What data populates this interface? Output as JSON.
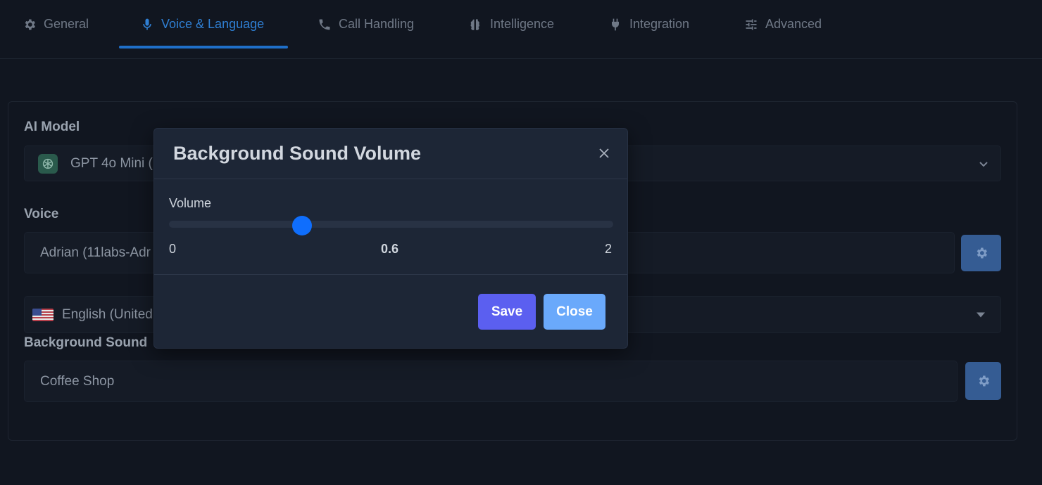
{
  "tabs": [
    {
      "label": "General",
      "icon": "gear-icon"
    },
    {
      "label": "Voice & Language",
      "icon": "microphone-icon",
      "active": true
    },
    {
      "label": "Call Handling",
      "icon": "phone-icon"
    },
    {
      "label": "Intelligence",
      "icon": "brain-icon"
    },
    {
      "label": "Integration",
      "icon": "plug-icon"
    },
    {
      "label": "Advanced",
      "icon": "sliders-icon"
    }
  ],
  "form": {
    "ai_model_label": "AI Model",
    "ai_model_value": "GPT 4o Mini (",
    "voice_label": "Voice",
    "voice_value": "Adrian (11labs-Adr",
    "language_value": "English (United S",
    "background_sound_label": "Background Sound",
    "background_sound_value": "Coffee Shop"
  },
  "modal": {
    "title": "Background Sound Volume",
    "volume_label": "Volume",
    "min": "0",
    "value": "0.6",
    "max": "2",
    "save_label": "Save",
    "close_label": "Close"
  },
  "colors": {
    "accent": "#2f7fd3",
    "slider_thumb": "#0f6efd",
    "save_button": "#5b5ff0",
    "close_button": "#6aa9fb"
  }
}
